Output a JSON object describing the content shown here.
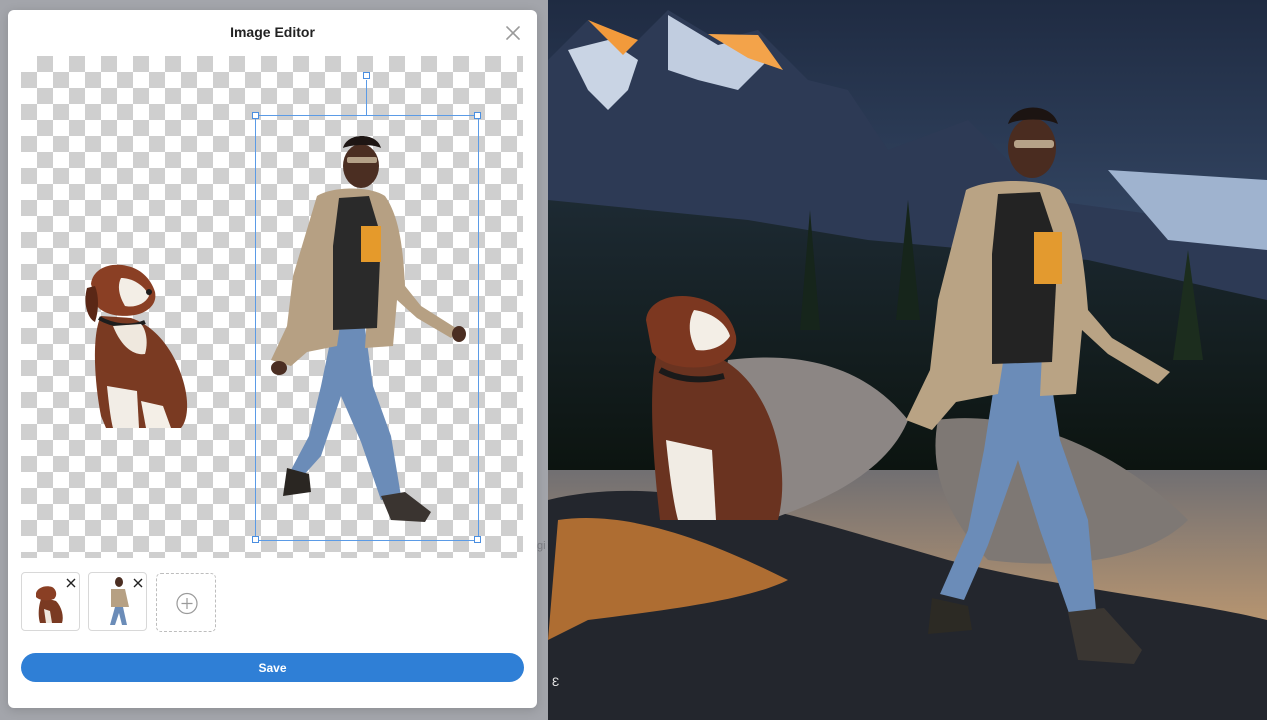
{
  "modal": {
    "title": "Image Editor",
    "close_icon": "close-icon",
    "save_label": "Save"
  },
  "canvas": {
    "layers": [
      "dog",
      "person"
    ],
    "selected_layer": "person"
  },
  "thumbnails": [
    {
      "name": "dog",
      "remove_icon": "close-icon"
    },
    {
      "name": "person",
      "remove_icon": "close-icon"
    }
  ],
  "add_icon": "plus-circle-icon",
  "backdrop": {
    "fragment": "gi"
  },
  "preview": {
    "corner_glyph": "Ɛ"
  },
  "colors": {
    "accent": "#2f7fd6",
    "selection": "#5b9be6",
    "checker_dark": "#cfcfcf",
    "sky_top": "#2b3d59",
    "sky_glow": "#e9b06b"
  }
}
